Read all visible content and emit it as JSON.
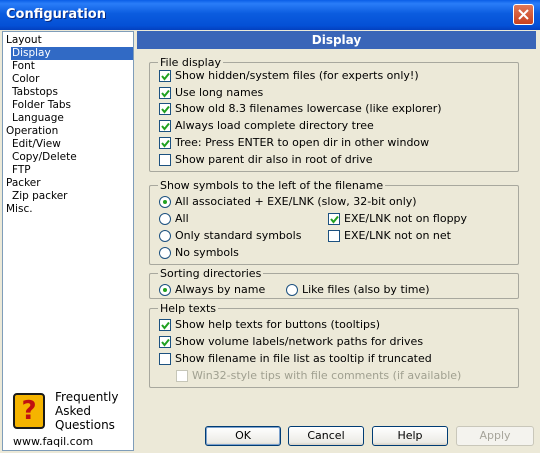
{
  "window": {
    "title": "Configuration"
  },
  "tree": {
    "items": [
      {
        "label": "Layout",
        "level": 0,
        "selected": false
      },
      {
        "label": "Display",
        "level": 1,
        "selected": true
      },
      {
        "label": "Font",
        "level": 1,
        "selected": false
      },
      {
        "label": "Color",
        "level": 1,
        "selected": false
      },
      {
        "label": "Tabstops",
        "level": 1,
        "selected": false
      },
      {
        "label": "Folder Tabs",
        "level": 1,
        "selected": false
      },
      {
        "label": "Language",
        "level": 1,
        "selected": false
      },
      {
        "label": "Operation",
        "level": 0,
        "selected": false
      },
      {
        "label": "Edit/View",
        "level": 1,
        "selected": false
      },
      {
        "label": "Copy/Delete",
        "level": 1,
        "selected": false
      },
      {
        "label": "FTP",
        "level": 1,
        "selected": false
      },
      {
        "label": "Packer",
        "level": 0,
        "selected": false
      },
      {
        "label": "Zip packer",
        "level": 1,
        "selected": false
      },
      {
        "label": "Misc.",
        "level": 0,
        "selected": false
      }
    ]
  },
  "logo": {
    "line1": "Frequently",
    "line2": "Asked",
    "line3": "Questions",
    "url": "www.faqil.com"
  },
  "panel": {
    "title": "Display"
  },
  "file_display": {
    "legend": "File display",
    "options": [
      {
        "label": "Show hidden/system files (for experts only!)",
        "checked": true
      },
      {
        "label": "Use long names",
        "checked": true
      },
      {
        "label": "Show old 8.3 filenames lowercase (like explorer)",
        "checked": true
      },
      {
        "label": "Always load complete directory tree",
        "checked": true
      },
      {
        "label": "Tree: Press ENTER to open dir in other window",
        "checked": true
      },
      {
        "label": "Show parent dir also in root of drive",
        "checked": false
      }
    ]
  },
  "symbols": {
    "legend": "Show symbols to the left of the filename",
    "radios": [
      {
        "label": "All associated + EXE/LNK (slow, 32-bit only)",
        "selected": true
      },
      {
        "label": "All",
        "selected": false
      },
      {
        "label": "Only standard symbols",
        "selected": false
      },
      {
        "label": "No symbols",
        "selected": false
      }
    ],
    "checks": [
      {
        "label": "EXE/LNK not on floppy",
        "checked": true
      },
      {
        "label": "EXE/LNK not on net",
        "checked": false
      }
    ]
  },
  "sorting": {
    "legend": "Sorting directories",
    "radios": [
      {
        "label": "Always by name",
        "selected": true
      },
      {
        "label": "Like files (also by time)",
        "selected": false
      }
    ]
  },
  "help": {
    "legend": "Help texts",
    "options": [
      {
        "label": "Show help texts for buttons (tooltips)",
        "checked": true,
        "disabled": false
      },
      {
        "label": "Show volume labels/network paths for drives",
        "checked": true,
        "disabled": false
      },
      {
        "label": "Show filename in file list as tooltip if truncated",
        "checked": false,
        "disabled": false
      },
      {
        "label": "Win32-style tips with file comments (if available)",
        "checked": false,
        "disabled": true
      }
    ]
  },
  "buttons": {
    "ok": "OK",
    "cancel": "Cancel",
    "help": "Help",
    "apply": "Apply"
  },
  "colors": {
    "title_bar": "#0a5ee6",
    "panel_header": "#3a65b8",
    "selection": "#316ac5",
    "checkmark": "#21a121"
  }
}
